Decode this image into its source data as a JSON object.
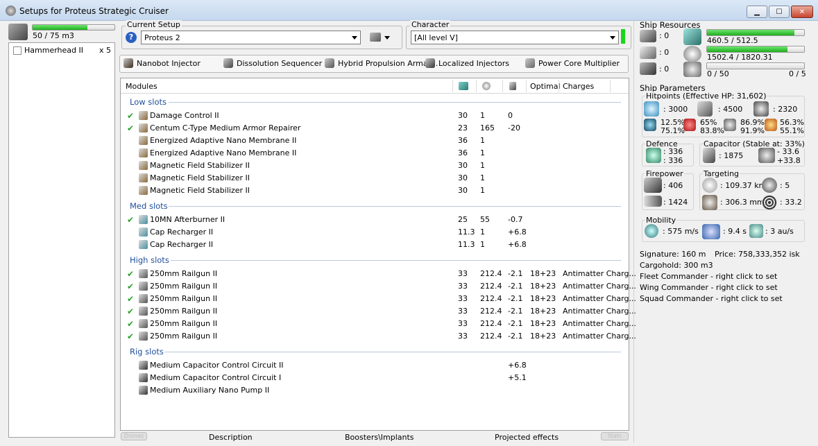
{
  "window": {
    "title": "Setups for Proteus Strategic Cruiser",
    "minimize": "▁",
    "maximize": "☐",
    "close": "✕"
  },
  "drones": {
    "capacity": "50 / 75 m3",
    "capacity_fraction": 0.6667,
    "list": [
      {
        "name": "Hammerhead II",
        "qty": "x 5"
      }
    ]
  },
  "setup": {
    "label": "Current Setup",
    "value": "Proteus 2",
    "help": "?"
  },
  "character": {
    "label": "Character",
    "value": "[All level V]"
  },
  "subsystems": [
    "Nanobot Injector",
    "Dissolution Sequencer",
    "Hybrid Propulsion Armat...",
    "Localized Injectors",
    "Power Core Multiplier"
  ],
  "modules_header": {
    "modules": "Modules",
    "optimal": "Optimal",
    "charges": "Charges"
  },
  "sections": {
    "low": "Low slots",
    "med": "Med slots",
    "high": "High slots",
    "rig": "Rig slots"
  },
  "low": [
    {
      "on": true,
      "name": "Damage Control II",
      "cpu": "30",
      "pg": "1",
      "cap": "0",
      "opt": "",
      "chg": ""
    },
    {
      "on": true,
      "name": "Centum C-Type Medium Armor Repairer",
      "cpu": "23",
      "pg": "165",
      "cap": "-20",
      "opt": "",
      "chg": ""
    },
    {
      "on": false,
      "name": "Energized Adaptive Nano Membrane II",
      "cpu": "36",
      "pg": "1",
      "cap": "",
      "opt": "",
      "chg": ""
    },
    {
      "on": false,
      "name": "Energized Adaptive Nano Membrane II",
      "cpu": "36",
      "pg": "1",
      "cap": "",
      "opt": "",
      "chg": ""
    },
    {
      "on": false,
      "name": "Magnetic Field Stabilizer II",
      "cpu": "30",
      "pg": "1",
      "cap": "",
      "opt": "",
      "chg": ""
    },
    {
      "on": false,
      "name": "Magnetic Field Stabilizer II",
      "cpu": "30",
      "pg": "1",
      "cap": "",
      "opt": "",
      "chg": ""
    },
    {
      "on": false,
      "name": "Magnetic Field Stabilizer II",
      "cpu": "30",
      "pg": "1",
      "cap": "",
      "opt": "",
      "chg": ""
    }
  ],
  "med": [
    {
      "on": true,
      "name": "10MN Afterburner II",
      "cpu": "25",
      "pg": "55",
      "cap": "-0.7",
      "opt": "",
      "chg": ""
    },
    {
      "on": false,
      "name": "Cap Recharger II",
      "cpu": "11.3",
      "pg": "1",
      "cap": "+6.8",
      "opt": "",
      "chg": ""
    },
    {
      "on": false,
      "name": "Cap Recharger II",
      "cpu": "11.3",
      "pg": "1",
      "cap": "+6.8",
      "opt": "",
      "chg": ""
    }
  ],
  "high": [
    {
      "on": true,
      "name": "250mm Railgun II",
      "cpu": "33",
      "pg": "212.4",
      "cap": "-2.1",
      "opt": "18+23",
      "chg": "Antimatter Charg..."
    },
    {
      "on": true,
      "name": "250mm Railgun II",
      "cpu": "33",
      "pg": "212.4",
      "cap": "-2.1",
      "opt": "18+23",
      "chg": "Antimatter Charg..."
    },
    {
      "on": true,
      "name": "250mm Railgun II",
      "cpu": "33",
      "pg": "212.4",
      "cap": "-2.1",
      "opt": "18+23",
      "chg": "Antimatter Charg..."
    },
    {
      "on": true,
      "name": "250mm Railgun II",
      "cpu": "33",
      "pg": "212.4",
      "cap": "-2.1",
      "opt": "18+23",
      "chg": "Antimatter Charg..."
    },
    {
      "on": true,
      "name": "250mm Railgun II",
      "cpu": "33",
      "pg": "212.4",
      "cap": "-2.1",
      "opt": "18+23",
      "chg": "Antimatter Charg..."
    },
    {
      "on": true,
      "name": "250mm Railgun II",
      "cpu": "33",
      "pg": "212.4",
      "cap": "-2.1",
      "opt": "18+23",
      "chg": "Antimatter Charg..."
    }
  ],
  "rig": [
    {
      "on": false,
      "name": "Medium Capacitor Control Circuit II",
      "cpu": "",
      "pg": "",
      "cap": "+6.8",
      "opt": "",
      "chg": ""
    },
    {
      "on": false,
      "name": "Medium Capacitor Control Circuit I",
      "cpu": "",
      "pg": "",
      "cap": "+5.1",
      "opt": "",
      "chg": ""
    },
    {
      "on": false,
      "name": "Medium Auxiliary Nano Pump II",
      "cpu": "",
      "pg": "",
      "cap": "",
      "opt": "",
      "chg": ""
    }
  ],
  "bottom_tabs": {
    "drones": "Drones",
    "description": "Description",
    "boosters": "Boosters\\Implants",
    "projected": "Projected effects",
    "stats": "Stats"
  },
  "resources": {
    "title": "Ship Resources",
    "turrets": ": 0",
    "launchers": ": 0",
    "drones_ctl": ": 0",
    "cpu": "460.5 / 512.5",
    "cpu_fraction": 0.8985,
    "powergrid": "1502.4 / 1820.31",
    "powergrid_fraction": 0.8254,
    "drone_bw": "0 / 50",
    "drone_bw_fraction": 0,
    "drones_active": "0 / 5"
  },
  "params": {
    "title": "Ship Parameters",
    "hp_title": "Hitpoints (Effective HP: 31,602)",
    "shield_hp": ": 3000",
    "armor_hp": ": 4500",
    "hull_hp": ": 2320",
    "shield_res": [
      "12.5%",
      "75.1%"
    ],
    "armor_res": [
      "65%",
      "83.8%"
    ],
    "armor_res2": [
      "86.9%",
      "91.9%"
    ],
    "hull_res": [
      "56.3%",
      "55.1%"
    ],
    "defence_title": "Defence",
    "defence": [
      ": 336",
      ": 336"
    ],
    "capacitor_title": "Capacitor (Stable at: 33%)",
    "cap_amount": ": 1875",
    "cap_delta": [
      "- 33.6",
      "+33.8"
    ],
    "firepower_title": "Firepower",
    "dps": ": 406",
    "volley": ": 1424",
    "targeting_title": "Targeting",
    "range": ": 109.37 km",
    "max_targets": ": 5",
    "scan_res": ": 306.3 mm",
    "sensor": ": 33.2",
    "mobility_title": "Mobility",
    "speed": ": 575 m/s",
    "align": ": 9.4 s",
    "warp": ": 3 au/s",
    "signature": "Signature: 160 m",
    "price": "Price: 758,333,352 isk",
    "cargo": "Cargohold: 300 m3",
    "fleet": "Fleet Commander - right click to set",
    "wing": "Wing Commander - right click to set",
    "squad": "Squad Commander - right click to set"
  },
  "icons": {
    "app": "proteus-icon",
    "help": "help-icon",
    "ship_menu": "ship-dropdown-icon",
    "check": "✔"
  },
  "colors": {
    "accent": "#1f4e9c",
    "bar_green": "#1eae1e",
    "check": "#2ca02c"
  }
}
